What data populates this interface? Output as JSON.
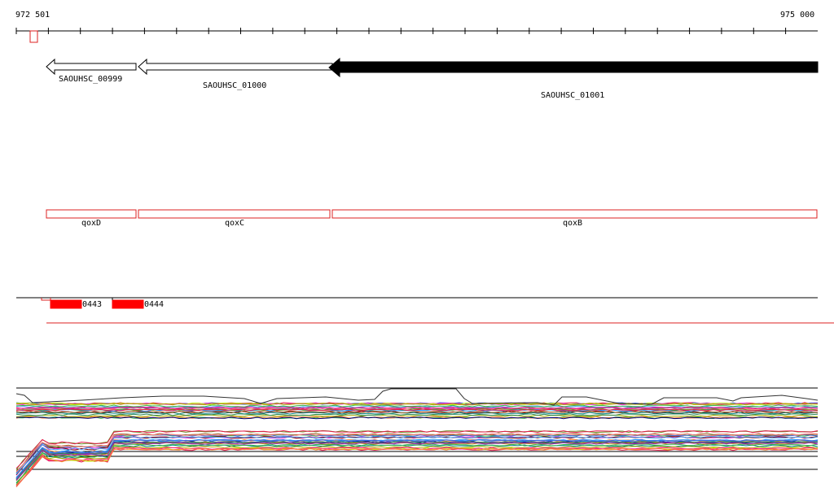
{
  "ruler": {
    "start_label": "972 501",
    "end_label": "975 000"
  },
  "genes": [
    {
      "id": "SAOUHSC_00999",
      "strand": "reverse",
      "filled": false
    },
    {
      "id": "SAOUHSC_01000",
      "strand": "reverse",
      "filled": false
    },
    {
      "id": "SAOUHSC_01001",
      "strand": "reverse",
      "filled": true
    }
  ],
  "gene_names": [
    "qoxD",
    "qoxC",
    "qoxB"
  ],
  "features": [
    "0443",
    "0444"
  ],
  "colors": {
    "gene_fill": "#000000",
    "gene_outline": "#000000",
    "feature_red": "#ff0000",
    "outline_red": "#dd2222"
  }
}
